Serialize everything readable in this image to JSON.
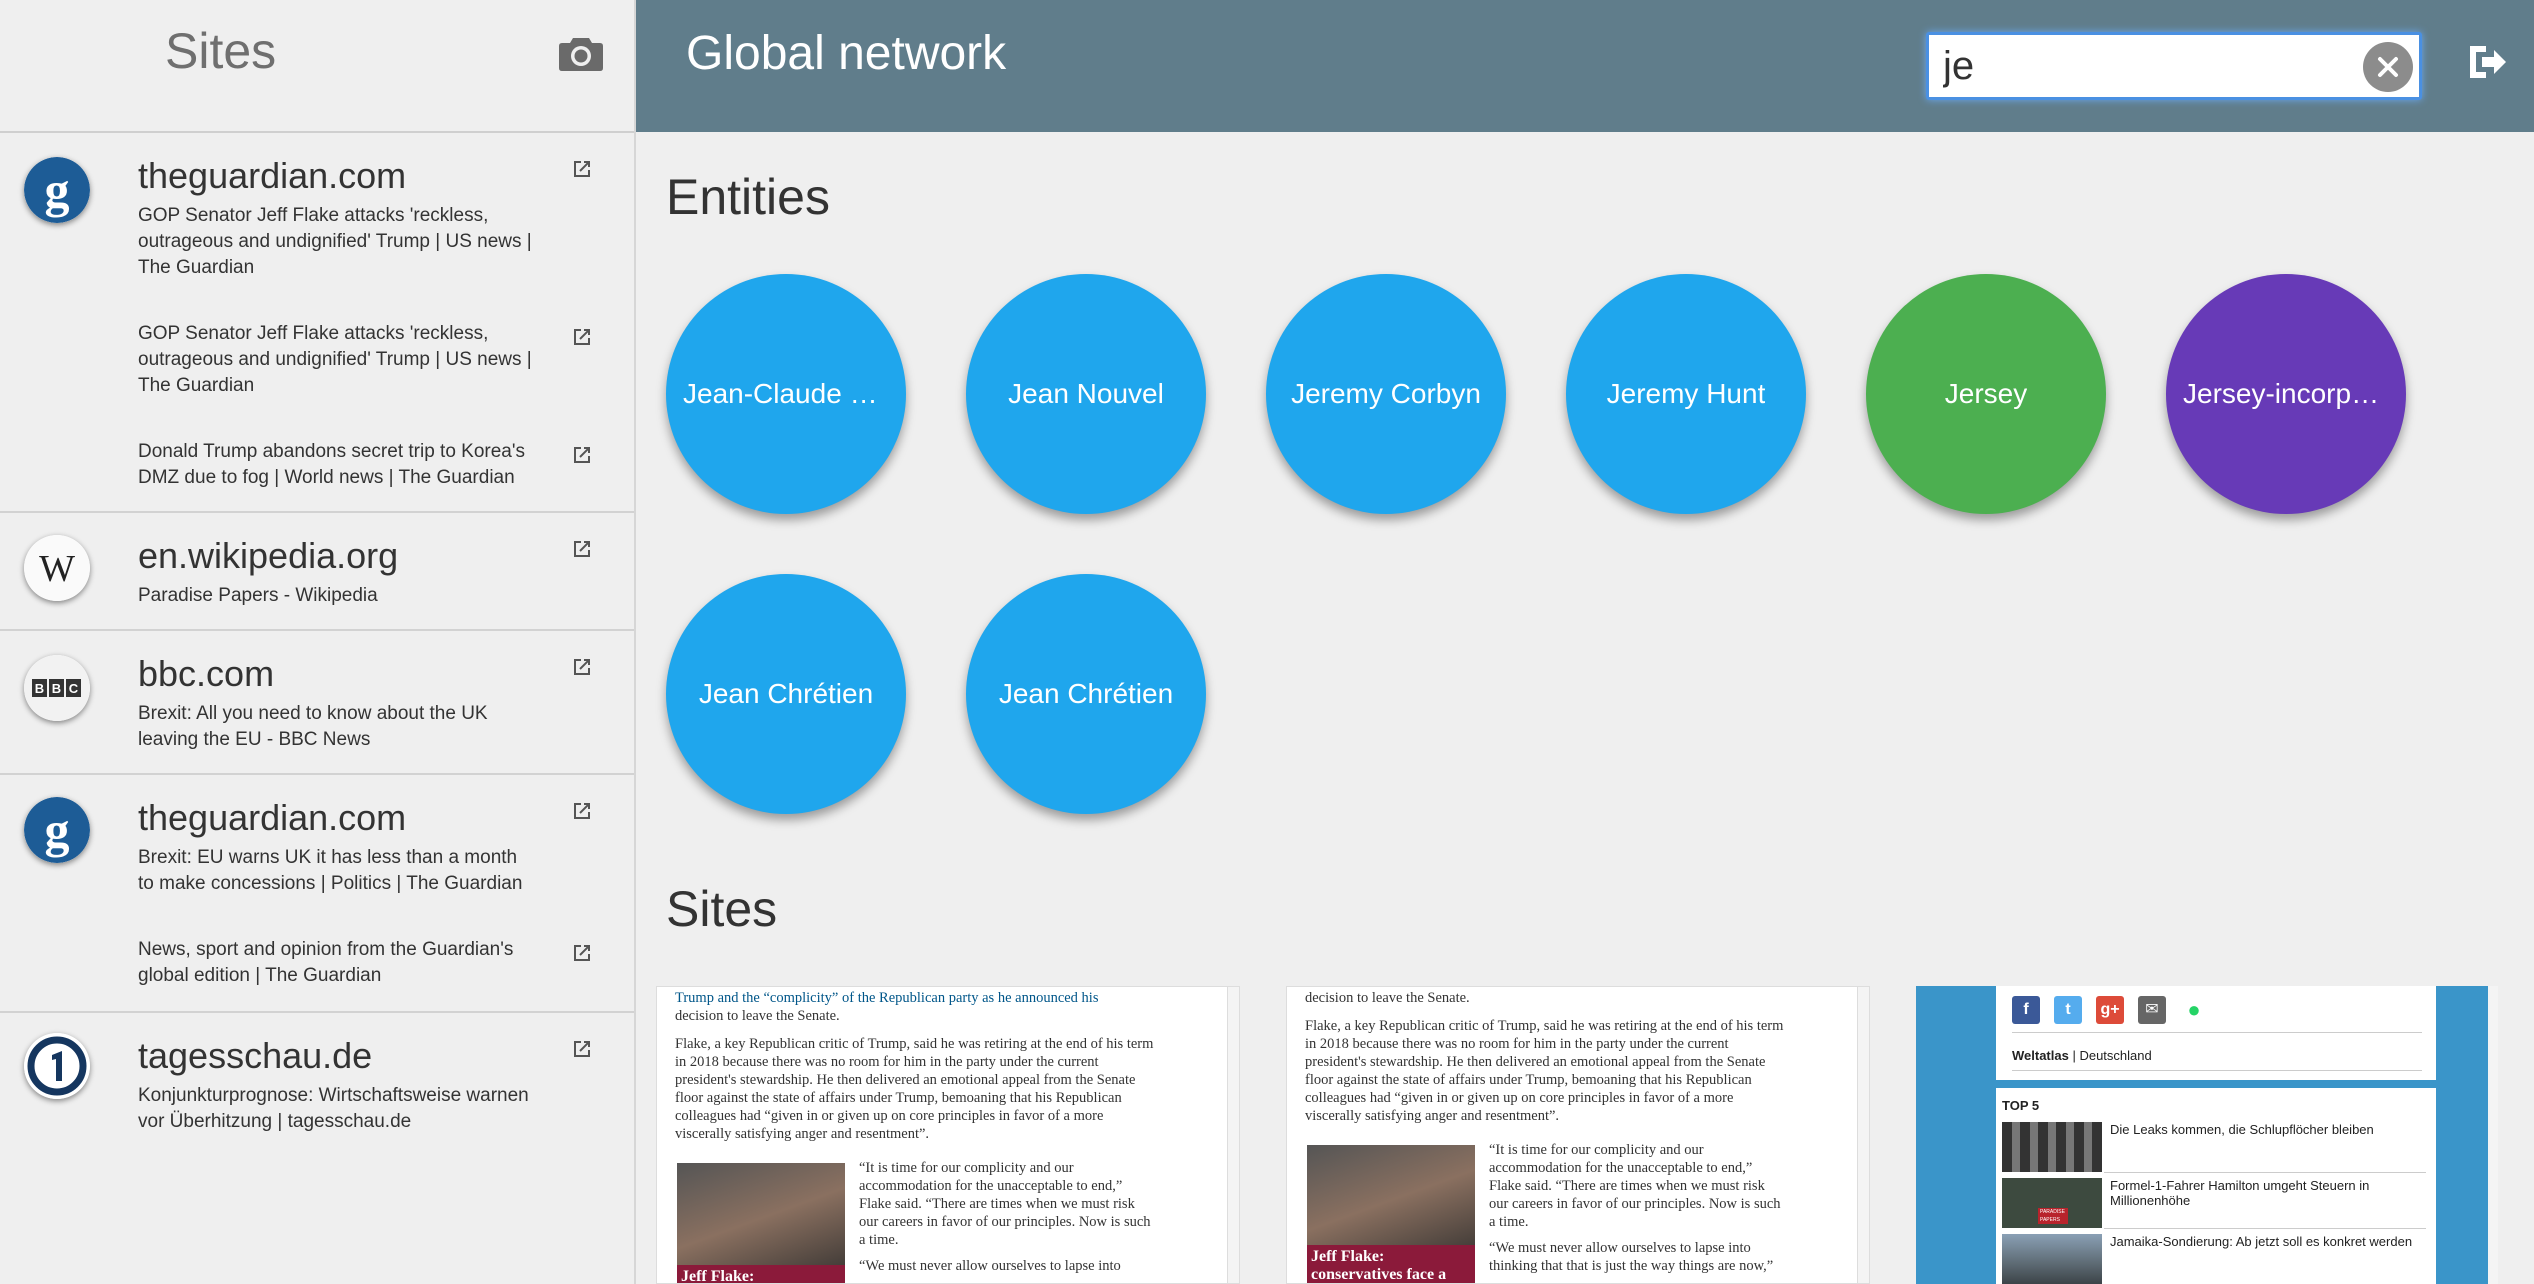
{
  "sidebar": {
    "title": "Sites",
    "groups": [
      {
        "domain": "theguardian.com",
        "logo": "guardian-g-logo",
        "pages": [
          "GOP Senator Jeff Flake attacks 'reckless, outrageous and undignified' Trump | US news | The Guardian",
          "GOP Senator Jeff Flake attacks 'reckless, outrageous and undignified' Trump | US news | The Guardian",
          "Donald Trump abandons secret trip to Korea's DMZ due to fog | World news | The Guardian"
        ]
      },
      {
        "domain": "en.wikipedia.org",
        "logo": "wikipedia-w-logo",
        "pages": [
          "Paradise Papers - Wikipedia"
        ]
      },
      {
        "domain": "bbc.com",
        "logo": "bbc-logo",
        "pages": [
          "Brexit: All you need to know about the UK leaving the EU - BBC News"
        ]
      },
      {
        "domain": "theguardian.com",
        "logo": "guardian-g-logo",
        "pages": [
          "Brexit: EU warns UK it has less than a month to make concessions | Politics | The Guardian",
          "News, sport and opinion from the Guardian's global edition | The Guardian"
        ]
      },
      {
        "domain": "tagesschau.de",
        "logo": "tagesschau-1-logo",
        "pages": [
          "Konjunkturprognose: Wirtschaftsweise warnen vor Überhitzung | tagesschau.de"
        ]
      }
    ]
  },
  "header": {
    "title": "Global network",
    "search_value": "je"
  },
  "entities_section": {
    "title": "Entities"
  },
  "entities": [
    {
      "label": "Jean-Claude Juncker",
      "color": "#1fa6ed"
    },
    {
      "label": "Jean Nouvel",
      "color": "#1fa6ed"
    },
    {
      "label": "Jeremy Corbyn",
      "color": "#1fa6ed"
    },
    {
      "label": "Jeremy Hunt",
      "color": "#1fa6ed"
    },
    {
      "label": "Jersey",
      "color": "#4caf50"
    },
    {
      "label": "Jersey-incorporated",
      "color": "#673ab7"
    },
    {
      "label": "Jean Chrétien",
      "color": "#1fa6ed"
    },
    {
      "label": "Jean Chrétien",
      "color": "#1fa6ed"
    }
  ],
  "sites_section": {
    "title": "Sites"
  },
  "thumbnails": {
    "guardian1": {
      "top_lines": [
        "Trump and the “complicity” of the Republican party as he announced his",
        "decision to leave the Senate."
      ],
      "para": [
        "Flake, a key Republican critic of Trump, said he was retiring at the end of his term",
        "in 2018 because there was no room for him in the party under the current",
        "president's stewardship. He then delivered an emotional appeal from the Senate",
        "floor against the state of affairs under Trump, bemoaning that his Republican",
        "colleagues had “given in or given up on core principles in favor of a more",
        "viscerally satisfying anger and resentment”."
      ],
      "quote": [
        "“It is time for our complicity and our",
        "accommodation for the unacceptable to end,”",
        "Flake said. “There are times when we must risk",
        "our careers in favor of our principles. Now is such",
        "a time."
      ],
      "quote2": [
        "“We must never allow ourselves to lapse into"
      ],
      "caption": "Jeff Flake:"
    },
    "guardian2": {
      "top_lines": [
        "decision to leave the Senate."
      ],
      "para": [
        "Flake, a key Republican critic of Trump, said he was retiring at the end of his term",
        "in 2018 because there was no room for him in the party under the current",
        "president's stewardship. He then delivered an emotional appeal from the Senate",
        "floor against the state of affairs under Trump, bemoaning that his Republican",
        "colleagues had “given in or given up on core principles in favor of a more",
        "viscerally satisfying anger and resentment”."
      ],
      "quote": [
        "“It is time for our complicity and our",
        "accommodation for the unacceptable to end,”",
        "Flake said. “There are times when we must risk",
        "our careers in favor of our principles. Now is such",
        "a time."
      ],
      "quote2": [
        "“We must never allow ourselves to lapse into",
        "thinking that that is just the way things are now,”"
      ],
      "caption": "Jeff Flake: conservatives face a"
    },
    "tagesschau": {
      "weltatlas": "Weltatlas",
      "country": "Deutschland",
      "top5": "TOP 5",
      "news": [
        "Die Leaks kommen, die Schlupflöcher bleiben",
        "Formel-1-Fahrer Hamilton umgeht Steuern in Millionenhöhe",
        "Jamaika-Sondierung: Ab jetzt soll es konkret werden"
      ],
      "paradise_label": "PARADISE PAPERS"
    }
  }
}
